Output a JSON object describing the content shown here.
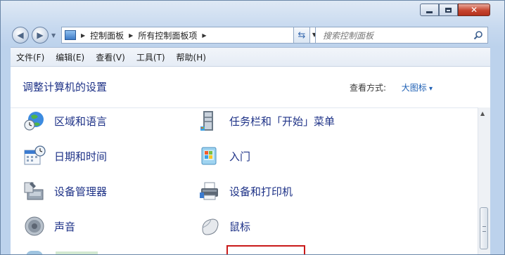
{
  "window": {
    "caption_buttons": [
      "minimize",
      "maximize",
      "close"
    ]
  },
  "nav": {
    "breadcrumbs": [
      "控制面板",
      "所有控制面板项"
    ],
    "search_placeholder": "搜索控制面板"
  },
  "menu": [
    "文件(F)",
    "编辑(E)",
    "查看(V)",
    "工具(T)",
    "帮助(H)"
  ],
  "content": {
    "title": "调整计算机的设置",
    "view_by_label": "查看方式:",
    "view_by_value": "大图标",
    "items": [
      {
        "label": "区域和语言",
        "icon": "globe-clock-icon"
      },
      {
        "label": "任务栏和「开始」菜单",
        "icon": "taskbar-icon"
      },
      {
        "label": "日期和时间",
        "icon": "calendar-clock-icon"
      },
      {
        "label": "入门",
        "icon": "getting-started-icon"
      },
      {
        "label": "设备管理器",
        "icon": "device-manager-icon"
      },
      {
        "label": "设备和打印机",
        "icon": "printer-icon"
      },
      {
        "label": "声音",
        "icon": "speaker-icon"
      },
      {
        "label": "鼠标",
        "icon": "mouse-icon"
      }
    ]
  },
  "colors": {
    "link": "#1e3287",
    "accent_box": "#c91a1a"
  }
}
